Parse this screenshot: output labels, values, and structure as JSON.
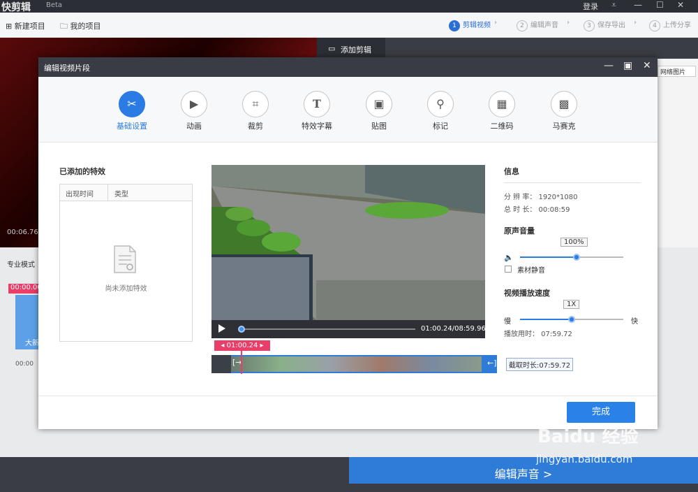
{
  "app": {
    "name": "快剪辑",
    "tag": "Beta",
    "login": "登录"
  },
  "toolbar": {
    "new_project": "新建项目",
    "my_projects": "我的项目",
    "steps": [
      {
        "num": "1",
        "label": "剪辑视频"
      },
      {
        "num": "2",
        "label": "编辑声音"
      },
      {
        "num": "3",
        "label": "保存导出"
      },
      {
        "num": "4",
        "label": "上传分享"
      }
    ]
  },
  "background": {
    "add_clip_tab": "添加剪辑",
    "net_image": "网络图片",
    "time": "00:06.76/",
    "mode": "专业模式",
    "clock": "00:00.00",
    "zero": "00:00",
    "clip_label": "大新",
    "edit_audio": "编辑声音 >"
  },
  "modal": {
    "title": "编辑视频片段",
    "tabs": [
      {
        "label": "基础设置",
        "icon": "scissors-icon",
        "glyph": "✂"
      },
      {
        "label": "动画",
        "icon": "animation-icon",
        "glyph": "▶"
      },
      {
        "label": "裁剪",
        "icon": "crop-icon",
        "glyph": "⌗"
      },
      {
        "label": "特效字幕",
        "icon": "text-icon",
        "glyph": "T"
      },
      {
        "label": "贴图",
        "icon": "image-icon",
        "glyph": "▣"
      },
      {
        "label": "标记",
        "icon": "pin-icon",
        "glyph": "⚲"
      },
      {
        "label": "二维码",
        "icon": "qrcode-icon",
        "glyph": "▦"
      },
      {
        "label": "马赛克",
        "icon": "mosaic-icon",
        "glyph": "▩"
      }
    ],
    "effects": {
      "title": "已添加的特效",
      "col_time": "出现时间",
      "col_type": "类型",
      "empty": "尚未添加特效"
    },
    "player": {
      "time": "01:00.24/08:59.96",
      "progress": 0.0,
      "marker": "01:00.24",
      "capture": "截取时长:07:59.72"
    },
    "info": {
      "title": "信息",
      "resolution": "分 辨 率： 1920*1080",
      "duration": "总 时 长： 00:08:59",
      "volume_title": "原声音量",
      "volume": "100%",
      "volume_value": 0.55,
      "mute": "素材静音",
      "speed_title": "视频播放速度",
      "speed": "1X",
      "speed_value": 0.5,
      "slow": "慢",
      "fast": "快",
      "play_time": "播放用时： 07:59.72"
    },
    "done": "完成"
  },
  "watermark": {
    "logo": "Baidu 经验",
    "url": "jingyan.baidu.com"
  }
}
